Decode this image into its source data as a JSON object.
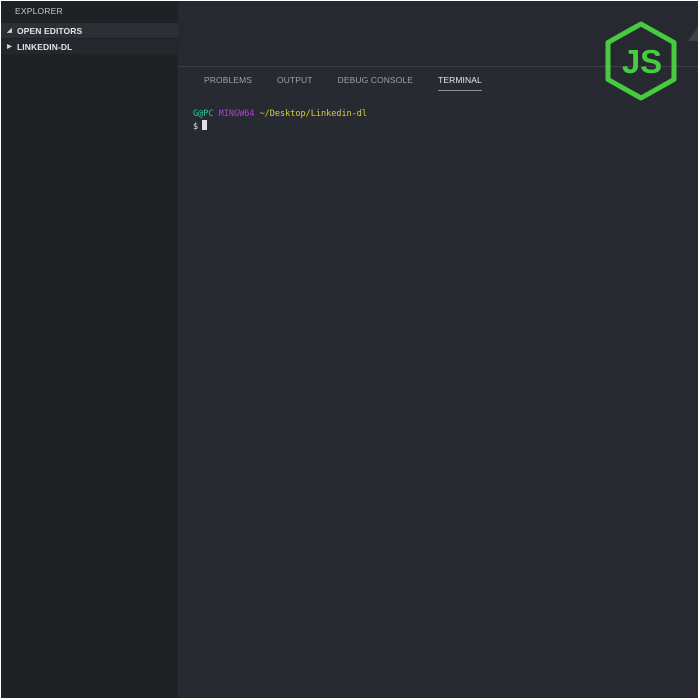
{
  "sidebar": {
    "title": "EXPLORER",
    "sections": [
      {
        "label": "OPEN EDITORS",
        "expanded": true
      },
      {
        "label": "LINKEDIN-DL",
        "expanded": false
      }
    ]
  },
  "panel": {
    "tabs": [
      {
        "label": "PROBLEMS",
        "active": false
      },
      {
        "label": "OUTPUT",
        "active": false
      },
      {
        "label": "DEBUG CONSOLE",
        "active": false
      },
      {
        "label": "TERMINAL",
        "active": true
      }
    ]
  },
  "terminal": {
    "user_host": "G@PC",
    "environment": "MINGW64",
    "path": "~/Desktop/Linkedin-dl",
    "prompt": "$"
  },
  "logo": {
    "text": "JS",
    "icon": "nodejs-hexagon-icon",
    "color": "#47cc3f"
  },
  "colors": {
    "sidebar_bg": "#1f2225",
    "panel_bg": "#272b31",
    "terminal_user": "#2ec4a0",
    "terminal_host": "#b23ed0",
    "terminal_path": "#d8cf39"
  }
}
